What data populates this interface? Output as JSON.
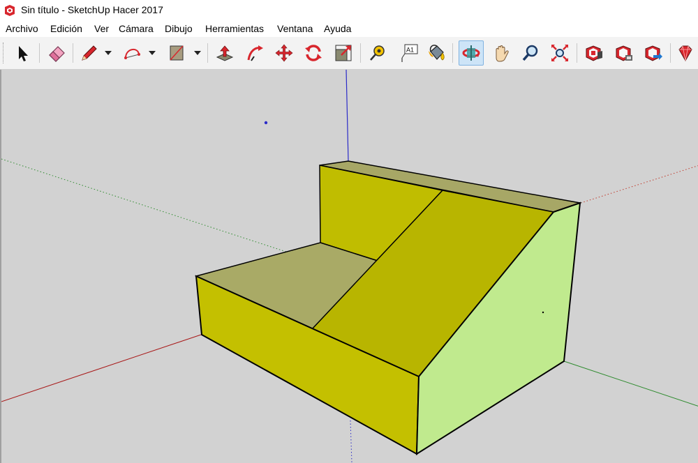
{
  "window": {
    "title": "Sin título - SketchUp Hacer 2017",
    "app_icon": "sketchup-logo-icon",
    "accent_color": "#d8262d"
  },
  "menubar": {
    "items": [
      {
        "label": "Archivo"
      },
      {
        "label": "Edición"
      },
      {
        "label": "Ver"
      },
      {
        "label": "Cámara"
      },
      {
        "label": "Dibujo"
      },
      {
        "label": "Herramientas"
      },
      {
        "label": "Ventana"
      },
      {
        "label": "Ayuda"
      }
    ]
  },
  "toolbar": {
    "tools": [
      {
        "icon": "select-arrow-icon"
      },
      {
        "icon": "eraser-icon"
      },
      {
        "icon": "pencil-line-icon"
      },
      {
        "icon": "arc-icon"
      },
      {
        "icon": "rectangle-icon"
      },
      {
        "icon": "push-pull-icon"
      },
      {
        "icon": "follow-me-icon"
      },
      {
        "icon": "move-icon"
      },
      {
        "icon": "rotate-icon"
      },
      {
        "icon": "scale-icon"
      },
      {
        "icon": "tape-measure-icon"
      },
      {
        "icon": "text-icon",
        "text": "A1"
      },
      {
        "icon": "paint-bucket-icon"
      },
      {
        "icon": "orbit-icon",
        "active": true
      },
      {
        "icon": "pan-hand-icon"
      },
      {
        "icon": "zoom-icon"
      },
      {
        "icon": "zoom-extents-icon"
      },
      {
        "icon": "3d-warehouse-icon"
      },
      {
        "icon": "share-model-icon"
      },
      {
        "icon": "extension-warehouse-icon"
      },
      {
        "icon": "ruby-console-icon"
      }
    ]
  },
  "viewport": {
    "background": "#d2d2d2",
    "axes": {
      "red": "#c0392b",
      "green": "#2e8b2e",
      "blue": "#2b2bc8"
    },
    "face_colors": {
      "front_yellow": "#c4c000",
      "slope_yellow": "#b8b500",
      "back_yellow": "#c0bd00",
      "flat_top_khaki": "#a9aa66",
      "back_top_khaki": "#a7a766",
      "side_green": "#c0ea8e"
    }
  }
}
